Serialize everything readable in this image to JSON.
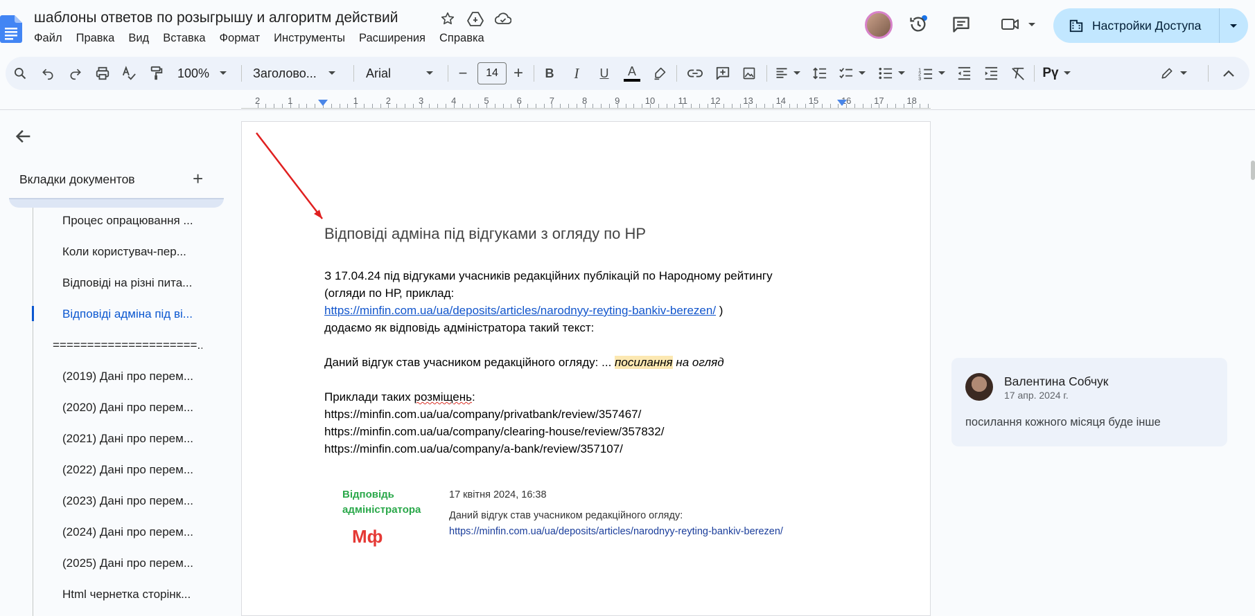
{
  "document": {
    "title": "шаблоны ответов по розыгрышу и алгоритм действий"
  },
  "menu": [
    "Файл",
    "Правка",
    "Вид",
    "Вставка",
    "Формат",
    "Инструменты",
    "Расширения",
    "Справка"
  ],
  "share": {
    "label": "Настройки Доступа"
  },
  "toolbar": {
    "zoom": "100%",
    "style": "Заголово...",
    "font": "Arial",
    "font_size": "14",
    "minus": "−",
    "plus": "+",
    "bold": "B",
    "italic": "I",
    "underline": "U",
    "text_color": "A"
  },
  "ruler": {
    "numbers": [
      "2",
      "1",
      "1",
      "2",
      "3",
      "4",
      "5",
      "6",
      "7",
      "8",
      "9",
      "10",
      "11",
      "12",
      "13",
      "14",
      "15",
      "16",
      "17",
      "18"
    ]
  },
  "sidebar": {
    "heading": "Вкладки документов",
    "add": "+",
    "items": [
      "Процес опрацювання ...",
      "Коли користувач-пер...",
      "Відповіді на різні пита...",
      "Відповіді адміна під ві...",
      "=====================...",
      "(2019) Дані про перем...",
      "(2020) Дані про перем...",
      "(2021) Дані про перем...",
      "(2022) Дані про перем...",
      "(2023) Дані про перем...",
      "(2024) Дані про перем...",
      "(2025) Дані про перем...",
      "Html чернетка сторінк..."
    ]
  },
  "content": {
    "heading": "Відповіді адміна під відгуками з огляду по НР",
    "p1_line1": "З 17.04.24 під відгуками учасників редакційних публікацій по Народному рейтингу",
    "p1_line2": "(огляди по НР, приклад:",
    "p1_link": "https://minfin.com.ua/ua/deposits/articles/narodnyy-reyting-bankiv-berezen/",
    "p1_link_after": " )",
    "p1_line4": "додаємо як відповідь адміністратора такий текст:",
    "p2_text": "Даний відгук став учасником редакційного огляду: ... ",
    "p2_highlight": "посилання",
    "p2_italic": " на огляд",
    "p3_prefix": "Приклади таких ",
    "p3_squiggle": "розміщень",
    "p3_suffix": ":",
    "examples": [
      "https://minfin.com.ua/ua/company/privatbank/review/357467/",
      "https://minfin.com.ua/ua/company/clearing-house/review/357832/",
      "https://minfin.com.ua/ua/company/a-bank/review/357107/"
    ]
  },
  "embedded": {
    "label_line1": "Відповідь",
    "label_line2": "адміністратора",
    "logo": "Мф",
    "date": "17 квітня 2024, 16:38",
    "text": "Даний відгук став учасником редакційного огляду:",
    "link": "https://minfin.com.ua/ua/deposits/articles/narodnyy-reyting-bankiv-berezen/"
  },
  "comment": {
    "author": "Валентина Собчук",
    "date": "17 апр. 2024 г.",
    "text": "посилання кожного місяця буде інше"
  },
  "colors": {
    "accent": "#0b57d0",
    "share_bg": "#c2e7ff",
    "toolbar_bg": "#edf2fa",
    "link": "#1155cc",
    "highlight": "#fce8b2",
    "arrow": "#e02020",
    "embedded_label": "#2aa84a",
    "logo_red": "#e53935"
  }
}
